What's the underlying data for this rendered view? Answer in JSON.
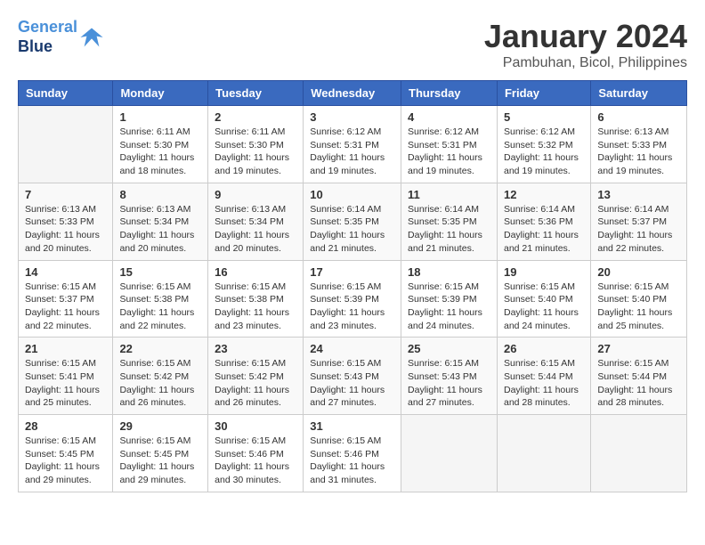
{
  "logo": {
    "line1": "General",
    "line2": "Blue"
  },
  "title": "January 2024",
  "location": "Pambuhan, Bicol, Philippines",
  "days_of_week": [
    "Sunday",
    "Monday",
    "Tuesday",
    "Wednesday",
    "Thursday",
    "Friday",
    "Saturday"
  ],
  "weeks": [
    [
      {
        "day": "",
        "info": ""
      },
      {
        "day": "1",
        "info": "Sunrise: 6:11 AM\nSunset: 5:30 PM\nDaylight: 11 hours\nand 18 minutes."
      },
      {
        "day": "2",
        "info": "Sunrise: 6:11 AM\nSunset: 5:30 PM\nDaylight: 11 hours\nand 19 minutes."
      },
      {
        "day": "3",
        "info": "Sunrise: 6:12 AM\nSunset: 5:31 PM\nDaylight: 11 hours\nand 19 minutes."
      },
      {
        "day": "4",
        "info": "Sunrise: 6:12 AM\nSunset: 5:31 PM\nDaylight: 11 hours\nand 19 minutes."
      },
      {
        "day": "5",
        "info": "Sunrise: 6:12 AM\nSunset: 5:32 PM\nDaylight: 11 hours\nand 19 minutes."
      },
      {
        "day": "6",
        "info": "Sunrise: 6:13 AM\nSunset: 5:33 PM\nDaylight: 11 hours\nand 19 minutes."
      }
    ],
    [
      {
        "day": "7",
        "info": "Sunrise: 6:13 AM\nSunset: 5:33 PM\nDaylight: 11 hours\nand 20 minutes."
      },
      {
        "day": "8",
        "info": "Sunrise: 6:13 AM\nSunset: 5:34 PM\nDaylight: 11 hours\nand 20 minutes."
      },
      {
        "day": "9",
        "info": "Sunrise: 6:13 AM\nSunset: 5:34 PM\nDaylight: 11 hours\nand 20 minutes."
      },
      {
        "day": "10",
        "info": "Sunrise: 6:14 AM\nSunset: 5:35 PM\nDaylight: 11 hours\nand 21 minutes."
      },
      {
        "day": "11",
        "info": "Sunrise: 6:14 AM\nSunset: 5:35 PM\nDaylight: 11 hours\nand 21 minutes."
      },
      {
        "day": "12",
        "info": "Sunrise: 6:14 AM\nSunset: 5:36 PM\nDaylight: 11 hours\nand 21 minutes."
      },
      {
        "day": "13",
        "info": "Sunrise: 6:14 AM\nSunset: 5:37 PM\nDaylight: 11 hours\nand 22 minutes."
      }
    ],
    [
      {
        "day": "14",
        "info": "Sunrise: 6:15 AM\nSunset: 5:37 PM\nDaylight: 11 hours\nand 22 minutes."
      },
      {
        "day": "15",
        "info": "Sunrise: 6:15 AM\nSunset: 5:38 PM\nDaylight: 11 hours\nand 22 minutes."
      },
      {
        "day": "16",
        "info": "Sunrise: 6:15 AM\nSunset: 5:38 PM\nDaylight: 11 hours\nand 23 minutes."
      },
      {
        "day": "17",
        "info": "Sunrise: 6:15 AM\nSunset: 5:39 PM\nDaylight: 11 hours\nand 23 minutes."
      },
      {
        "day": "18",
        "info": "Sunrise: 6:15 AM\nSunset: 5:39 PM\nDaylight: 11 hours\nand 24 minutes."
      },
      {
        "day": "19",
        "info": "Sunrise: 6:15 AM\nSunset: 5:40 PM\nDaylight: 11 hours\nand 24 minutes."
      },
      {
        "day": "20",
        "info": "Sunrise: 6:15 AM\nSunset: 5:40 PM\nDaylight: 11 hours\nand 25 minutes."
      }
    ],
    [
      {
        "day": "21",
        "info": "Sunrise: 6:15 AM\nSunset: 5:41 PM\nDaylight: 11 hours\nand 25 minutes."
      },
      {
        "day": "22",
        "info": "Sunrise: 6:15 AM\nSunset: 5:42 PM\nDaylight: 11 hours\nand 26 minutes."
      },
      {
        "day": "23",
        "info": "Sunrise: 6:15 AM\nSunset: 5:42 PM\nDaylight: 11 hours\nand 26 minutes."
      },
      {
        "day": "24",
        "info": "Sunrise: 6:15 AM\nSunset: 5:43 PM\nDaylight: 11 hours\nand 27 minutes."
      },
      {
        "day": "25",
        "info": "Sunrise: 6:15 AM\nSunset: 5:43 PM\nDaylight: 11 hours\nand 27 minutes."
      },
      {
        "day": "26",
        "info": "Sunrise: 6:15 AM\nSunset: 5:44 PM\nDaylight: 11 hours\nand 28 minutes."
      },
      {
        "day": "27",
        "info": "Sunrise: 6:15 AM\nSunset: 5:44 PM\nDaylight: 11 hours\nand 28 minutes."
      }
    ],
    [
      {
        "day": "28",
        "info": "Sunrise: 6:15 AM\nSunset: 5:45 PM\nDaylight: 11 hours\nand 29 minutes."
      },
      {
        "day": "29",
        "info": "Sunrise: 6:15 AM\nSunset: 5:45 PM\nDaylight: 11 hours\nand 29 minutes."
      },
      {
        "day": "30",
        "info": "Sunrise: 6:15 AM\nSunset: 5:46 PM\nDaylight: 11 hours\nand 30 minutes."
      },
      {
        "day": "31",
        "info": "Sunrise: 6:15 AM\nSunset: 5:46 PM\nDaylight: 11 hours\nand 31 minutes."
      },
      {
        "day": "",
        "info": ""
      },
      {
        "day": "",
        "info": ""
      },
      {
        "day": "",
        "info": ""
      }
    ]
  ]
}
